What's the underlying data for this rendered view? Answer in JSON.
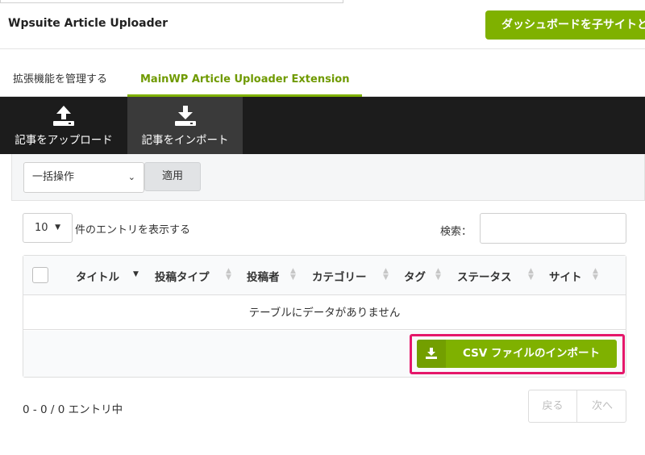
{
  "header": {
    "title": "Wpsuite Article Uploader",
    "dashboard_button": "ダッシュボードを子サイトと"
  },
  "extension_tabs": [
    {
      "label": "拡張機能を管理する",
      "active": false
    },
    {
      "label": "MainWP Article Uploader Extension",
      "active": true
    }
  ],
  "dark_tabs": [
    {
      "label": "記事をアップロード",
      "icon": "upload-icon",
      "active": false
    },
    {
      "label": "記事をインポート",
      "icon": "download-icon",
      "active": true
    }
  ],
  "bulk": {
    "selected": "一括操作",
    "apply": "適用"
  },
  "table_controls": {
    "length_value": "10",
    "length_suffix": "件のエントリを表示する",
    "search_label": "検索："
  },
  "table": {
    "columns": [
      "タイトル",
      "投稿タイプ",
      "投稿者",
      "カテゴリー",
      "タグ",
      "ステータス",
      "サイト"
    ],
    "empty_message": "テーブルにデータがありません"
  },
  "import_button": "CSV ファイルのインポート",
  "footer": {
    "info": "0 - 0 / 0 エントリ中",
    "prev": "戻る",
    "next": "次へ"
  },
  "colors": {
    "accent": "#7fb100",
    "highlight": "#e5176a",
    "dark_bar": "#1c1c1c"
  }
}
